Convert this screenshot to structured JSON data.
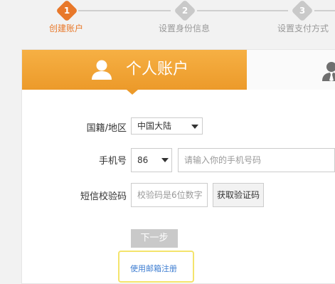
{
  "stepper": {
    "steps": [
      {
        "number": "1",
        "label": "创建账户",
        "state": "active"
      },
      {
        "number": "2",
        "label": "设置身份信息",
        "state": "inactive"
      },
      {
        "number": "3",
        "label": "设置支付方式",
        "state": "inactive"
      }
    ]
  },
  "tabs": {
    "personal_label": "个人账户",
    "personal_icon": "user-icon",
    "other_icon": "business-user-icon"
  },
  "form": {
    "country_label": "国籍/地区",
    "country_value": "中国大陆",
    "phone_label": "手机号",
    "phone_code_value": "86",
    "phone_placeholder": "请输入你的手机号码",
    "sms_label": "短信校验码",
    "sms_placeholder": "校验码是6位数字",
    "get_code_label": "获取验证码",
    "next_label": "下一步",
    "email_register_label": "使用邮箱注册"
  },
  "colors": {
    "accent": "#e8782a",
    "tab_orange": "#f29f32",
    "link": "#3d7dd1",
    "highlight": "#f4e46c"
  }
}
